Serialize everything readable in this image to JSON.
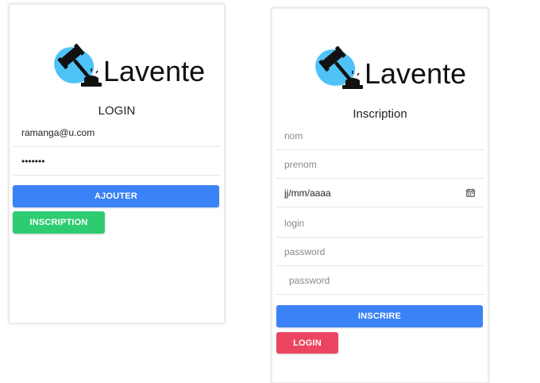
{
  "colors": {
    "primary_blue": "#3b82f6",
    "success_green": "#2ecc71",
    "danger_red": "#ec4561",
    "logo_blob": "#4fc3f7"
  },
  "login_card": {
    "logo": {
      "text": "Lavente",
      "icon": "gavel-icon"
    },
    "title": "LOGIN",
    "email_value": "ramanga@u.com",
    "password_value": "1234567",
    "submit_label": "AJOUTER",
    "signup_label": "INSCRIPTION"
  },
  "signup_card": {
    "logo": {
      "text": "Lavente",
      "icon": "gavel-icon"
    },
    "title": "Inscription",
    "fields": {
      "nom_placeholder": "nom",
      "prenom_placeholder": "prenom",
      "date_display": "jj/mm/aaaa",
      "login_placeholder": "login",
      "password_placeholder": "password",
      "password_confirm_placeholder": "password"
    },
    "date_icon": "calendar-icon",
    "submit_label": "INSCRIRE",
    "login_label": "LOGIN"
  }
}
